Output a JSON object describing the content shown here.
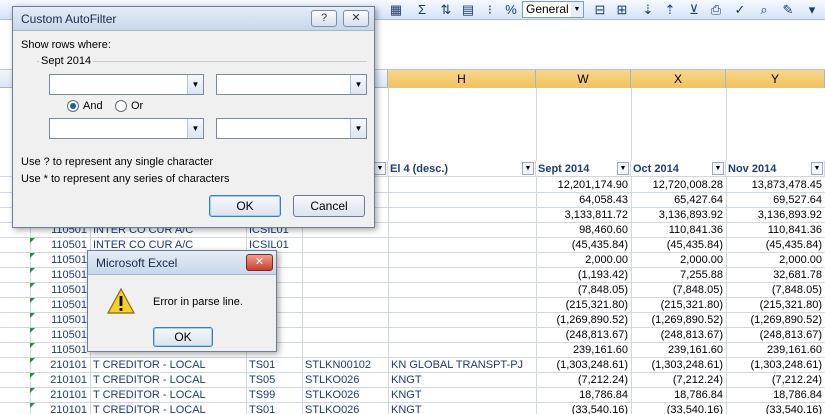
{
  "toolbar": {
    "sigma": "Σ",
    "percent": "%",
    "number_format": "General"
  },
  "columns": {
    "h": "H",
    "w": "W",
    "x": "X",
    "y": "Y"
  },
  "filter_headers": {
    "el4": "El 4 (desc.)",
    "sept": "Sept 2014",
    "oct": "Oct 2014",
    "nov": "Nov 2014"
  },
  "rows": [
    {
      "a": "",
      "b": "",
      "c": "",
      "d": "",
      "e": "",
      "w": "12,201,174.90",
      "x": "12,720,008.28",
      "y": "13,873,478.45"
    },
    {
      "a": "",
      "b": "",
      "c": "",
      "d": "",
      "e": "",
      "w": "64,058.43",
      "x": "65,427.64",
      "y": "69,527.64"
    },
    {
      "a": "",
      "b": "",
      "c": "",
      "d": "",
      "e": "",
      "w": "3,133,811.72",
      "x": "3,136,893.92",
      "y": "3,136,893.92"
    },
    {
      "a": "110501",
      "b": "INTER CO CUR A/C",
      "c": "ICSIL01",
      "d": "",
      "e": "",
      "w": "98,460.60",
      "x": "110,841.36",
      "y": "110,841.36"
    },
    {
      "a": "110501",
      "b": "INTER CO CUR A/C",
      "c": "ICSIL01",
      "d": "",
      "e": "",
      "w": "(45,435.84)",
      "x": "(45,435.84)",
      "y": "(45,435.84)"
    },
    {
      "a": "110501",
      "b": "",
      "c": "",
      "d": "",
      "e": "",
      "w": "2,000.00",
      "x": "2,000.00",
      "y": "2,000.00"
    },
    {
      "a": "110501",
      "b": "",
      "c": "",
      "d": "",
      "e": "",
      "w": "(1,193.42)",
      "x": "7,255.88",
      "y": "32,681.78"
    },
    {
      "a": "110501",
      "b": "",
      "c": "",
      "d": "",
      "e": "",
      "w": "(7,848.05)",
      "x": "(7,848.05)",
      "y": "(7,848.05)"
    },
    {
      "a": "110501",
      "b": "",
      "c": "",
      "d": "",
      "e": "",
      "w": "(215,321.80)",
      "x": "(215,321.80)",
      "y": "(215,321.80)"
    },
    {
      "a": "110501",
      "b": "",
      "c": "",
      "d": "",
      "e": "",
      "w": "(1,269,890.52)",
      "x": "(1,269,890.52)",
      "y": "(1,269,890.52)"
    },
    {
      "a": "110501",
      "b": "",
      "c": "",
      "d": "",
      "e": "",
      "w": "(248,813.67)",
      "x": "(248,813.67)",
      "y": "(248,813.67)"
    },
    {
      "a": "110501",
      "b": "",
      "c": "",
      "d": "",
      "e": "",
      "w": "239,161.60",
      "x": "239,161.60",
      "y": "239,161.60"
    },
    {
      "a": "210101",
      "b": "T CREDITOR - LOCAL",
      "c": "TS01",
      "d": "STLKN00102",
      "e": "KN GLOBAL TRANSPT-PJ",
      "w": "(1,303,248.61)",
      "x": "(1,303,248.61)",
      "y": "(1,303,248.61)"
    },
    {
      "a": "210101",
      "b": "T CREDITOR - LOCAL",
      "c": "TS05",
      "d": "STLKO026",
      "e": "KNGT",
      "w": "(7,212.24)",
      "x": "(7,212.24)",
      "y": "(7,212.24)"
    },
    {
      "a": "210101",
      "b": "T CREDITOR - LOCAL",
      "c": "TS99",
      "d": "STLKO026",
      "e": "KNGT",
      "w": "18,786.84",
      "x": "18,786.84",
      "y": "18,786.84"
    },
    {
      "a": "210101",
      "b": "T CREDITOR - LOCAL",
      "c": "TS01",
      "d": "STLKO026",
      "e": "KNGT",
      "w": "(33,540.16)",
      "x": "(33,540.16)",
      "y": "(33,540.16)"
    }
  ],
  "autofilter": {
    "title": "Custom AutoFilter",
    "help": "?",
    "close": "✕",
    "show_rows": "Show rows where:",
    "field": "Sept 2014",
    "and_label": "And",
    "or_label": "Or",
    "hint1": "Use ? to represent any single character",
    "hint2": "Use * to represent any series of characters",
    "ok": "OK",
    "cancel": "Cancel"
  },
  "error_dialog": {
    "title": "Microsoft Excel",
    "close": "✕",
    "message": "Error in parse line.",
    "ok": "OK"
  }
}
